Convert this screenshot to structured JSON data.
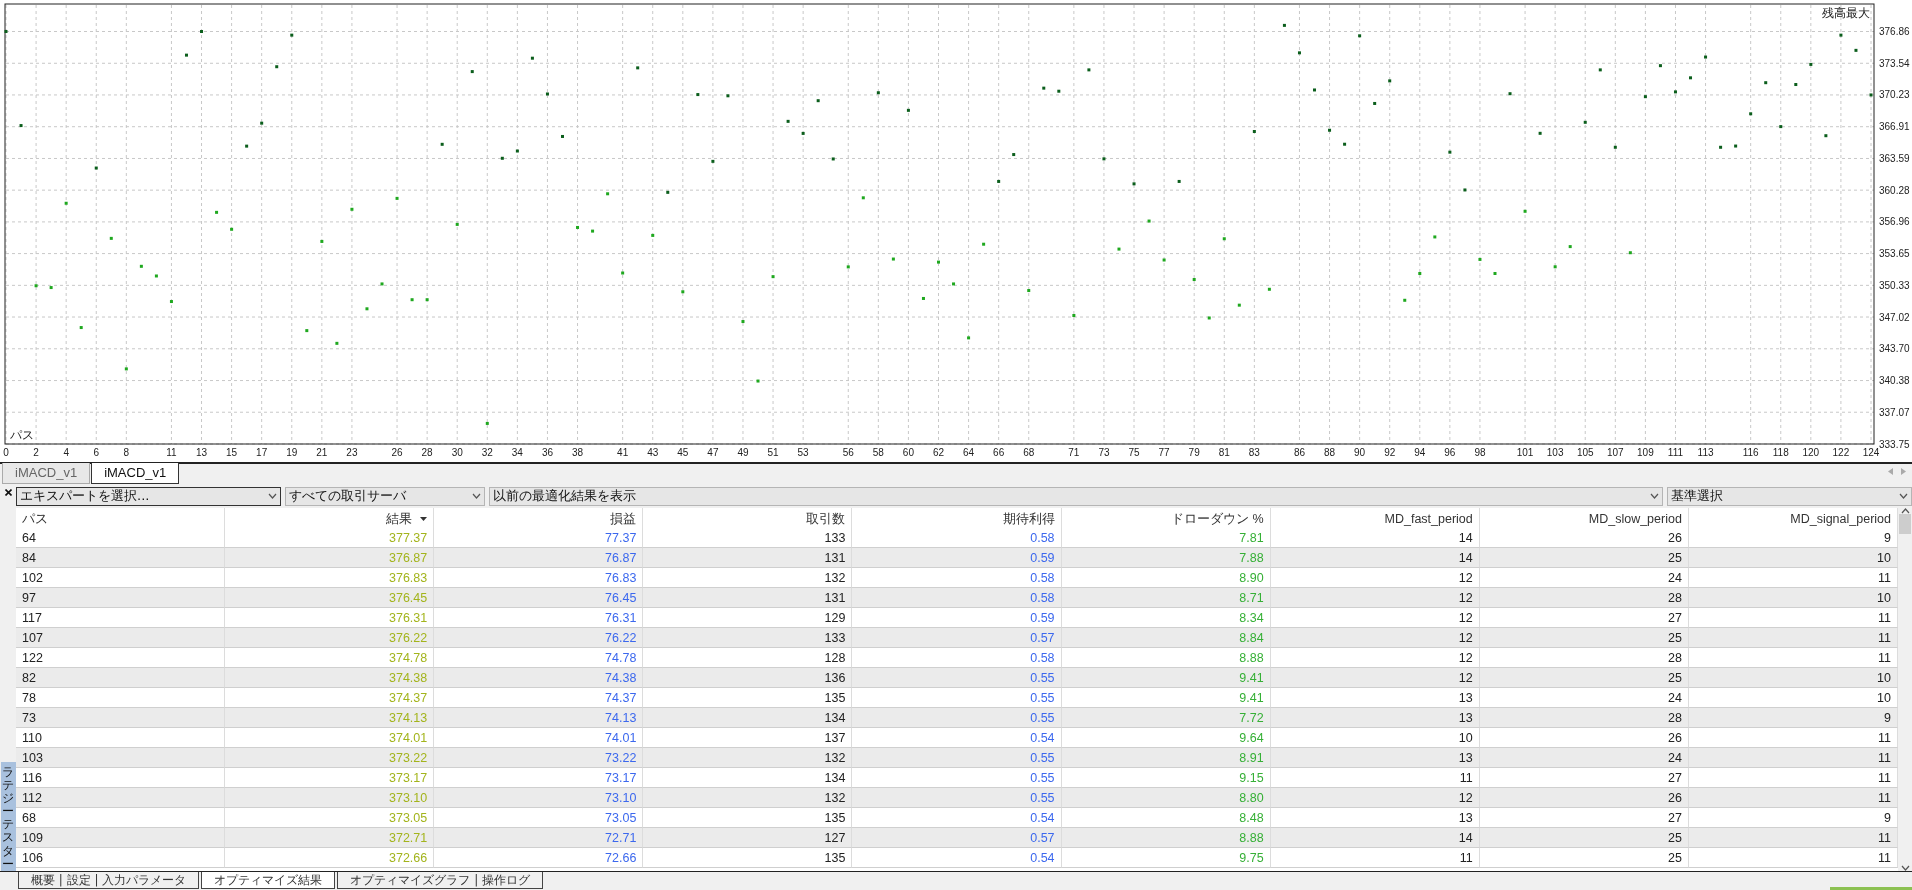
{
  "chart": {
    "chart_data": {
      "type": "scatter",
      "xlabel": "パス",
      "ylabel": "残高最大",
      "xlim": [
        0,
        124
      ],
      "ylim": [
        333.75,
        379.63
      ],
      "x": [
        0,
        1,
        2,
        3,
        4,
        5,
        6,
        7,
        8,
        9,
        10,
        11,
        12,
        13,
        14,
        15,
        16,
        17,
        18,
        19,
        20,
        21,
        22,
        23,
        24,
        25,
        26,
        27,
        28,
        29,
        30,
        31,
        32,
        33,
        34,
        35,
        36,
        37,
        38,
        39,
        40,
        41,
        42,
        43,
        44,
        45,
        46,
        47,
        48,
        49,
        50,
        51,
        52,
        53,
        54,
        55,
        56,
        57,
        58,
        59,
        60,
        61,
        62,
        63,
        64,
        65,
        66,
        67,
        68,
        69,
        70,
        71,
        72,
        73,
        74,
        75,
        76,
        77,
        78,
        79,
        80,
        81,
        82,
        83,
        84,
        85,
        86,
        87,
        88,
        89,
        90,
        91,
        92,
        93,
        94,
        95,
        96,
        97,
        98,
        99,
        100,
        101,
        102,
        103,
        104,
        105,
        106,
        107,
        108,
        109,
        110,
        111,
        112,
        113,
        114,
        115,
        116,
        117,
        118,
        119,
        120,
        121,
        122,
        123,
        124
      ],
      "series": [
        {
          "color": "#0b5e1c",
          "values": [
            376.86,
            367.03,
            null,
            null,
            null,
            null,
            362.59,
            null,
            null,
            null,
            null,
            null,
            374.39,
            376.86,
            null,
            null,
            364.88,
            367.28,
            373.18,
            376.48,
            null,
            null,
            null,
            null,
            null,
            null,
            null,
            null,
            null,
            365.07,
            null,
            372.67,
            null,
            363.61,
            364.37,
            374.07,
            370.33,
            365.89,
            null,
            null,
            null,
            null,
            373.06,
            null,
            360.05,
            null,
            370.27,
            363.29,
            370.14,
            null,
            null,
            null,
            367.47,
            366.21,
            369.63,
            363.54,
            null,
            null,
            370.46,
            null,
            368.62,
            null,
            null,
            null,
            null,
            null,
            361.19,
            364.0,
            null,
            370.94,
            370.62,
            null,
            372.85,
            363.55,
            null,
            360.94,
            null,
            null,
            361.19,
            null,
            null,
            null,
            null,
            366.41,
            null,
            377.5,
            374.63,
            370.75,
            366.54,
            365.08,
            376.41,
            369.34,
            371.7,
            null,
            null,
            null,
            364.25,
            360.3,
            null,
            null,
            370.36,
            null,
            366.22,
            null,
            null,
            367.37,
            372.85,
            364.76,
            null,
            370.05,
            373.29,
            370.55,
            372.02,
            374.19,
            364.76,
            364.89,
            368.26,
            371.51,
            366.92,
            371.32,
            373.42,
            365.97,
            376.48,
            374.89,
            370.23
          ]
        },
        {
          "color": "#1fa81f",
          "values": [
            null,
            null,
            350.29,
            350.1,
            358.91,
            345.92,
            null,
            355.24,
            341.6,
            352.32,
            351.31,
            348.64,
            null,
            null,
            357.96,
            356.19,
            null,
            null,
            null,
            null,
            345.6,
            354.92,
            344.27,
            358.28,
            347.88,
            350.48,
            359.42,
            348.83,
            348.83,
            null,
            356.7,
            null,
            335.9,
            null,
            null,
            null,
            null,
            null,
            356.38,
            356.0,
            359.9,
            351.62,
            null,
            355.55,
            null,
            349.66,
            null,
            null,
            null,
            346.55,
            340.33,
            351.24,
            null,
            null,
            null,
            null,
            352.26,
            359.48,
            null,
            353.08,
            null,
            348.96,
            352.76,
            350.48,
            344.84,
            354.63,
            null,
            null,
            349.79,
            null,
            null,
            347.18,
            null,
            null,
            354.12,
            null,
            357.05,
            352.98,
            null,
            350.94,
            346.92,
            355.2,
            348.26,
            null,
            349.92,
            null,
            null,
            null,
            null,
            null,
            null,
            null,
            null,
            348.77,
            351.57,
            355.39,
            null,
            null,
            353.04,
            351.57,
            null,
            358.07,
            null,
            352.27,
            354.38,
            null,
            null,
            null,
            353.74,
            null,
            null,
            null,
            null,
            null,
            null,
            null,
            null,
            null,
            null,
            null,
            null,
            null,
            null,
            null,
            null
          ]
        }
      ],
      "yticks": [
        {
          "value": 333.75,
          "label": "333.75"
        },
        {
          "value": 337.07,
          "label": "337.07"
        },
        {
          "value": 340.38,
          "label": "340.38"
        },
        {
          "value": 343.7,
          "label": "343.70"
        },
        {
          "value": 347.02,
          "label": "347.02"
        },
        {
          "value": 350.33,
          "label": "350.33"
        },
        {
          "value": 353.65,
          "label": "353.65"
        },
        {
          "value": 356.96,
          "label": "356.96"
        },
        {
          "value": 360.28,
          "label": "360.28"
        },
        {
          "value": 363.59,
          "label": "363.59"
        },
        {
          "value": 366.91,
          "label": "366.91"
        },
        {
          "value": 370.23,
          "label": "370.23"
        },
        {
          "value": 373.54,
          "label": "373.54"
        },
        {
          "value": 376.86,
          "label": "376.86"
        }
      ],
      "xticks": [
        0,
        2,
        4,
        6,
        8,
        11,
        13,
        15,
        17,
        19,
        21,
        23,
        26,
        28,
        30,
        32,
        34,
        36,
        38,
        41,
        43,
        45,
        47,
        49,
        51,
        53,
        56,
        58,
        60,
        62,
        64,
        66,
        68,
        71,
        73,
        75,
        77,
        79,
        81,
        83,
        86,
        88,
        90,
        92,
        94,
        96,
        98,
        101,
        103,
        105,
        107,
        109,
        111,
        113,
        116,
        118,
        120,
        122,
        124
      ],
      "grid": true
    }
  },
  "tabs": [
    {
      "label": "iMACD_v1",
      "selected": false
    },
    {
      "label": "iMACD_v1",
      "selected": true
    }
  ],
  "filters": [
    {
      "value": "エキスパートを選択...",
      "focused": true
    },
    {
      "value": "すべての取引サーバ",
      "focused": false
    },
    {
      "value": "以前の最適化結果を表示",
      "focused": false
    },
    {
      "value": "基準選択",
      "focused": false
    }
  ],
  "table": {
    "columns": [
      {
        "label": "パス",
        "color": "#222222",
        "sorted": false
      },
      {
        "label": "結果",
        "color": "#a3b41c",
        "sorted": true
      },
      {
        "label": "損益",
        "color": "#3c68ee",
        "sorted": false
      },
      {
        "label": "取引数",
        "color": "#222222",
        "sorted": false
      },
      {
        "label": "期待利得",
        "color": "#3c68ee",
        "sorted": false
      },
      {
        "label": "ドローダウン %",
        "color": "#36b036",
        "sorted": false
      },
      {
        "label": "MD_fast_period",
        "color": "#222222",
        "sorted": false
      },
      {
        "label": "MD_slow_period",
        "color": "#222222",
        "sorted": false
      },
      {
        "label": "MD_signal_period",
        "color": "#222222",
        "sorted": false
      }
    ],
    "rows": [
      [
        "64",
        "377.37",
        "77.37",
        "133",
        "0.58",
        "7.81",
        "14",
        "26",
        "9"
      ],
      [
        "84",
        "376.87",
        "76.87",
        "131",
        "0.59",
        "7.88",
        "14",
        "25",
        "10"
      ],
      [
        "102",
        "376.83",
        "76.83",
        "132",
        "0.58",
        "8.90",
        "12",
        "24",
        "11"
      ],
      [
        "97",
        "376.45",
        "76.45",
        "131",
        "0.58",
        "8.71",
        "12",
        "28",
        "10"
      ],
      [
        "117",
        "376.31",
        "76.31",
        "129",
        "0.59",
        "8.34",
        "12",
        "27",
        "11"
      ],
      [
        "107",
        "376.22",
        "76.22",
        "133",
        "0.57",
        "8.84",
        "12",
        "25",
        "11"
      ],
      [
        "122",
        "374.78",
        "74.78",
        "128",
        "0.58",
        "8.88",
        "12",
        "28",
        "11"
      ],
      [
        "82",
        "374.38",
        "74.38",
        "136",
        "0.55",
        "9.41",
        "12",
        "25",
        "10"
      ],
      [
        "78",
        "374.37",
        "74.37",
        "135",
        "0.55",
        "9.41",
        "13",
        "24",
        "10"
      ],
      [
        "73",
        "374.13",
        "74.13",
        "134",
        "0.55",
        "7.72",
        "13",
        "28",
        "9"
      ],
      [
        "110",
        "374.01",
        "74.01",
        "137",
        "0.54",
        "9.64",
        "10",
        "26",
        "11"
      ],
      [
        "103",
        "373.22",
        "73.22",
        "132",
        "0.55",
        "8.91",
        "13",
        "24",
        "11"
      ],
      [
        "116",
        "373.17",
        "73.17",
        "134",
        "0.55",
        "9.15",
        "11",
        "27",
        "11"
      ],
      [
        "112",
        "373.10",
        "73.10",
        "132",
        "0.55",
        "8.80",
        "12",
        "26",
        "11"
      ],
      [
        "68",
        "373.05",
        "73.05",
        "135",
        "0.54",
        "8.48",
        "13",
        "27",
        "9"
      ],
      [
        "109",
        "372.71",
        "72.71",
        "127",
        "0.57",
        "8.88",
        "14",
        "25",
        "11"
      ],
      [
        "106",
        "372.66",
        "72.66",
        "135",
        "0.54",
        "9.75",
        "11",
        "25",
        "11"
      ]
    ]
  },
  "side_panel": {
    "title": "ラテジーテスター"
  },
  "bottom_tabs": [
    {
      "label": "概要 | 設定 | 入力パラメータ",
      "selected": false
    },
    {
      "label": "オプティマイズ結果",
      "selected": true
    },
    {
      "label": "オプティマイズグラフ | 操作ログ",
      "selected": false
    }
  ]
}
